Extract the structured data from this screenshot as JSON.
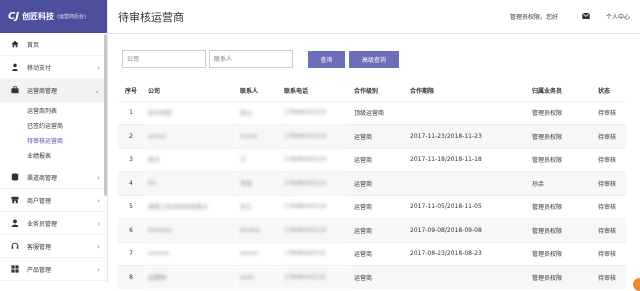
{
  "brand": {
    "logo": "CJ",
    "name": "创匠科技",
    "sub": "(运营商后台)"
  },
  "page_title": "待审核运营商",
  "header": {
    "account": "管理员权限，您好",
    "user_center": "个人中心"
  },
  "sidebar": {
    "items": [
      {
        "label": "首页",
        "icon": "home-icon"
      },
      {
        "label": "移动支付",
        "icon": "person-icon"
      },
      {
        "label": "运营商管理",
        "icon": "briefcase-icon"
      },
      {
        "label": "渠道商管理",
        "icon": "database-icon"
      },
      {
        "label": "商户管理",
        "icon": "shop-icon"
      },
      {
        "label": "业务员管理",
        "icon": "user-icon"
      },
      {
        "label": "客服管理",
        "icon": "headset-icon"
      },
      {
        "label": "产品管理",
        "icon": "grid-icon"
      }
    ],
    "submenu": [
      {
        "label": "运营商列表"
      },
      {
        "label": "已签约运营商"
      },
      {
        "label": "待审核运营商"
      },
      {
        "label": "业绩报表"
      }
    ]
  },
  "filters": {
    "company_placeholder": "公司",
    "contact_placeholder": "联系人",
    "query_label": "查询",
    "all_label": "高级查询"
  },
  "table": {
    "headers": [
      "序号",
      "公司",
      "联系人",
      "联系电话",
      "合作级别",
      "合作期限",
      "归属业务员",
      "状态"
    ],
    "rows": [
      {
        "no": "1",
        "company": "杭州创匠",
        "contact": "张山",
        "phone": "17898043210",
        "level": "顶级运营商",
        "period": "",
        "owner": "管理员权限",
        "status": "待审核"
      },
      {
        "no": "2",
        "company": "xxxxx",
        "contact": "xxxxx",
        "phone": "17898043210",
        "level": "运营商",
        "period": "2017-11-23/2018-11-23",
        "owner": "管理员权限",
        "status": "待审核"
      },
      {
        "no": "3",
        "company": "君立",
        "contact": "订",
        "phone": "17898043210",
        "level": "运营商",
        "period": "2017-11-18/2018-11-18",
        "owner": "管理员权限",
        "status": "待审核"
      },
      {
        "no": "4",
        "company": "lilu",
        "contact": "李陆",
        "phone": "17898043210",
        "level": "运营商",
        "period": "",
        "owner": "孙余",
        "status": "待审核"
      },
      {
        "no": "5",
        "company": "湖南三折风科技有限公",
        "contact": "刘工",
        "phone": "17898043210",
        "level": "运营商",
        "period": "2017-11-05/2018-11-05",
        "owner": "管理员权限",
        "status": "待审核"
      },
      {
        "no": "6",
        "company": "Gestaza",
        "contact": "zhuhai",
        "phone": "17898043210",
        "level": "运营商",
        "period": "2017-09-08/2018-09-08",
        "owner": "管理员权限",
        "status": "待审核"
      },
      {
        "no": "7",
        "company": "xxxxxx",
        "contact": "xxxxx",
        "phone": "17898043210",
        "level": "运营商",
        "period": "2017-08-23/2018-08-23",
        "owner": "管理员权限",
        "status": "待审核"
      },
      {
        "no": "8",
        "company": "设置物",
        "contact": "xxxx",
        "phone": "17898043210",
        "level": "运营商",
        "period": "",
        "owner": "管理员权限",
        "status": "待审核"
      }
    ]
  },
  "colors": {
    "brand": "#4c4f9b",
    "button": "#6c6fb7",
    "active_sub": "#4c4f9b",
    "float": "#f08a2e"
  }
}
